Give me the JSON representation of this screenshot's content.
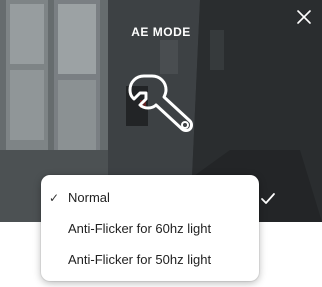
{
  "header": {
    "title": "AE MODE",
    "close_icon": "close-icon"
  },
  "mode_icon": "wrench-icon",
  "confirm_icon": "checkmark-icon",
  "ae_mode_menu": {
    "selected": "Normal",
    "check_glyph": "✓",
    "options": [
      {
        "label": "Normal",
        "selected": true
      },
      {
        "label": "Anti-Flicker for 60hz light",
        "selected": false
      },
      {
        "label": "Anti-Flicker for 50hz light",
        "selected": false
      }
    ]
  },
  "colors": {
    "overlay_text": "#ffffff",
    "menu_background": "#ffffff",
    "menu_text": "#222222"
  }
}
